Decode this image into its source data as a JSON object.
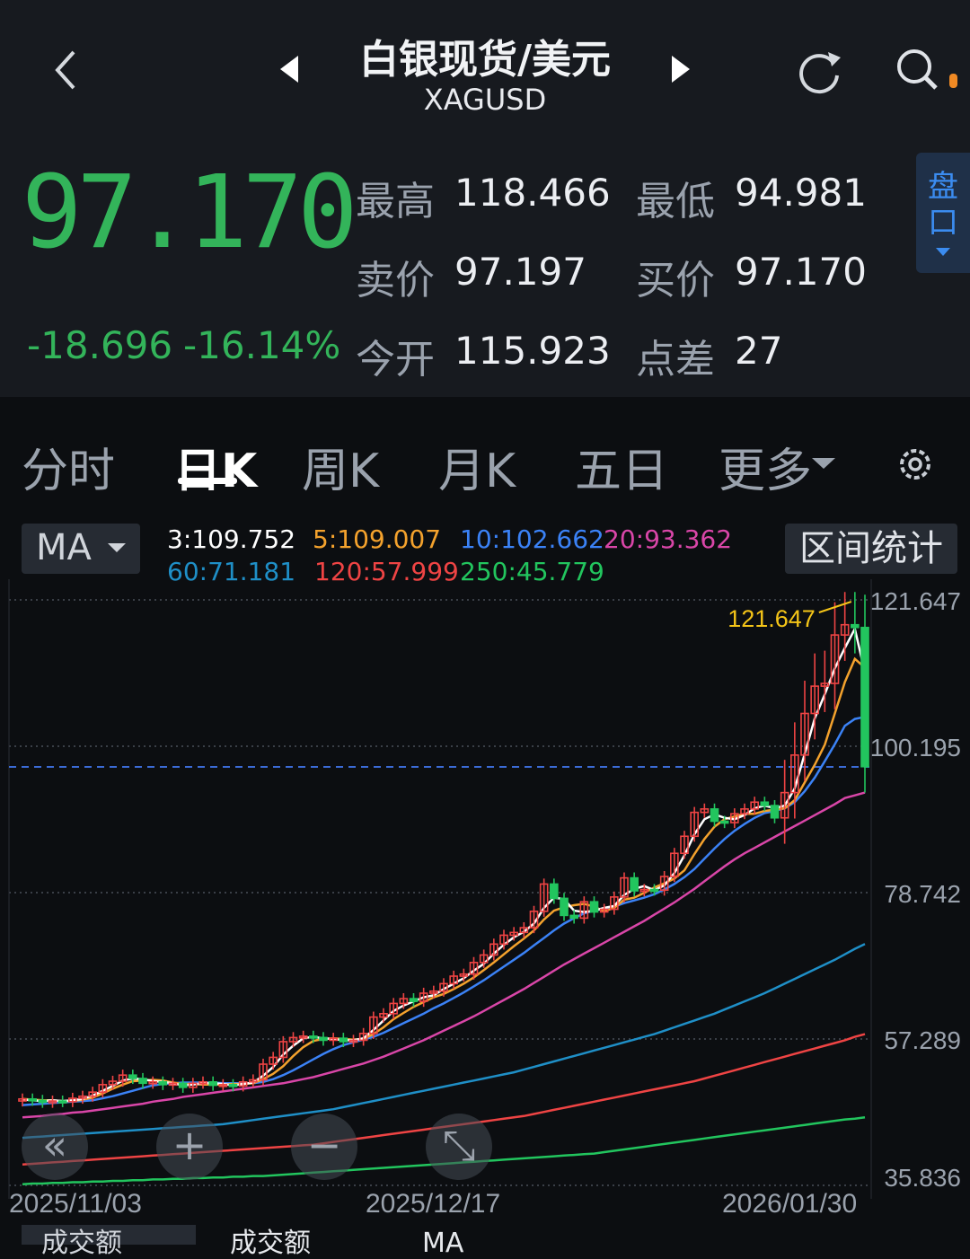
{
  "header": {
    "title": "白银现货/美元",
    "symbol": "XAGUSD",
    "price": "97.170",
    "change": "-18.696",
    "change_pct": "-16.14%",
    "stats": [
      {
        "label": "最高",
        "value": "118.466"
      },
      {
        "label": "最低",
        "value": "94.981"
      },
      {
        "label": "卖价",
        "value": "97.197"
      },
      {
        "label": "买价",
        "value": "97.170"
      },
      {
        "label": "今开",
        "value": "115.923"
      },
      {
        "label": "点差",
        "value": "27"
      }
    ],
    "pankou_label": [
      "盘",
      "口"
    ],
    "icons": {
      "back": "chevron-left-icon",
      "prev": "triangle-left-icon",
      "next": "triangle-right-icon",
      "refresh": "refresh-icon",
      "search": "search-icon"
    }
  },
  "tabs": [
    {
      "label": "分时",
      "active": false
    },
    {
      "label": "日K",
      "active": true
    },
    {
      "label": "周K",
      "active": false
    },
    {
      "label": "月K",
      "active": false
    },
    {
      "label": "五日",
      "active": false
    },
    {
      "label": "更多",
      "active": false
    }
  ],
  "indicator": {
    "select_label": "MA",
    "stats_button": "区间统计",
    "ma": [
      {
        "label": "3:109.752",
        "color": "#ffffff"
      },
      {
        "label": "5:109.007",
        "color": "#f4a22d"
      },
      {
        "label": "10:102.662",
        "color": "#3b82f6"
      },
      {
        "label": "20:93.362",
        "color": "#d946a8"
      },
      {
        "label": "60:71.181",
        "color": "#1f8fc7"
      },
      {
        "label": "120:57.999",
        "color": "#ef4444"
      },
      {
        "label": "250:45.779",
        "color": "#22c55e"
      }
    ]
  },
  "controls": [
    "«",
    "+",
    "−",
    "⤡"
  ],
  "chart_data": {
    "type": "candlestick",
    "y_ticks": [
      "121.647",
      "100.195",
      "78.742",
      "57.289",
      "35.836"
    ],
    "x_ticks": [
      "2025/11/03",
      "2025/12/17",
      "2026/01/30"
    ],
    "ylim": [
      35.836,
      121.647
    ],
    "current_price_line": 97.17,
    "max_marker_label": "121.647",
    "close": [
      48.5,
      48.3,
      48.0,
      48.2,
      48.1,
      48.6,
      48.9,
      49.5,
      50.6,
      51.1,
      52.0,
      51.5,
      50.8,
      51.0,
      50.6,
      50.8,
      50.2,
      50.8,
      51.0,
      50.5,
      50.6,
      50.4,
      51.0,
      51.3,
      53.6,
      54.6,
      56.9,
      57.5,
      57.7,
      57.5,
      57.1,
      57.4,
      56.9,
      57.1,
      58.1,
      60.5,
      61.0,
      62.5,
      63.2,
      62.8,
      64.0,
      64.3,
      65.4,
      66.5,
      66.8,
      68.5,
      69.6,
      71.2,
      72.5,
      72.9,
      73.6,
      76.0,
      80.0,
      77.9,
      75.4,
      75.0,
      77.4,
      75.9,
      76.3,
      78.1,
      80.9,
      79.0,
      79.2,
      79.1,
      81.1,
      84.5,
      87.0,
      90.5,
      91.0,
      89.2,
      89.0,
      90.3,
      91.0,
      92.0,
      91.5,
      89.7,
      93.4,
      98.9,
      105.0,
      109.0,
      109.4,
      116.5,
      118.0,
      117.6,
      97.2
    ],
    "ma": {
      "ma3": [
        48.4,
        48.3,
        48.2,
        48.3,
        48.2,
        48.3,
        48.5,
        49.0,
        49.7,
        50.4,
        51.2,
        51.5,
        51.4,
        51.1,
        51.0,
        50.8,
        50.5,
        50.6,
        50.8,
        50.8,
        50.7,
        50.5,
        50.7,
        50.9,
        51.9,
        53.2,
        55.0,
        56.3,
        57.4,
        57.6,
        57.4,
        57.3,
        57.1,
        57.1,
        57.4,
        58.6,
        60.0,
        61.4,
        62.2,
        62.8,
        63.4,
        63.7,
        64.6,
        65.4,
        66.2,
        67.3,
        68.3,
        69.8,
        71.1,
        72.2,
        73.0,
        74.2,
        76.5,
        78.0,
        77.8,
        76.1,
        75.9,
        76.1,
        76.5,
        76.8,
        78.4,
        79.3,
        79.7,
        79.1,
        79.8,
        81.6,
        84.2,
        87.3,
        89.5,
        90.2,
        89.7,
        89.5,
        90.1,
        91.1,
        91.5,
        91.1,
        91.5,
        94.0,
        99.1,
        104.3,
        107.8,
        111.6,
        114.6,
        117.4,
        111.0
      ],
      "ma5": [
        48.5,
        48.4,
        48.3,
        48.3,
        48.2,
        48.2,
        48.4,
        48.7,
        49.3,
        50.0,
        50.6,
        51.1,
        51.2,
        51.3,
        51.2,
        50.9,
        50.7,
        50.7,
        50.6,
        50.6,
        50.6,
        50.7,
        50.7,
        50.8,
        51.4,
        52.2,
        53.3,
        54.8,
        56.1,
        57.0,
        57.3,
        57.4,
        57.3,
        57.2,
        57.3,
        58.0,
        59.0,
        60.2,
        61.1,
        62.0,
        62.7,
        63.4,
        63.9,
        64.6,
        65.4,
        66.3,
        67.4,
        68.5,
        69.7,
        70.9,
        72.0,
        73.2,
        74.8,
        76.1,
        76.6,
        76.9,
        77.1,
        76.7,
        76.0,
        76.5,
        77.7,
        78.0,
        78.7,
        79.5,
        80.1,
        80.8,
        82.0,
        84.4,
        86.6,
        88.4,
        89.5,
        89.9,
        90.3,
        90.3,
        90.7,
        90.9,
        91.1,
        92.3,
        94.9,
        97.5,
        100.4,
        105.0,
        109.6,
        113.0,
        111.7
      ],
      "ma10": [
        47.6,
        47.7,
        47.8,
        47.9,
        48.0,
        48.1,
        48.2,
        48.3,
        48.6,
        48.9,
        49.3,
        49.7,
        50.1,
        50.5,
        50.7,
        50.8,
        50.9,
        50.9,
        50.9,
        50.9,
        50.8,
        50.8,
        50.8,
        50.8,
        51.0,
        51.4,
        52.0,
        52.7,
        53.5,
        54.3,
        55.1,
        55.8,
        56.4,
        56.8,
        57.2,
        57.6,
        58.2,
        58.9,
        59.6,
        60.3,
        61.0,
        61.8,
        62.5,
        63.3,
        64.1,
        65.0,
        65.9,
        66.9,
        67.9,
        68.9,
        69.9,
        71.0,
        72.1,
        73.2,
        74.2,
        75.0,
        75.7,
        76.1,
        76.4,
        76.7,
        77.2,
        77.6,
        78.0,
        78.5,
        79.2,
        80.0,
        81.0,
        82.2,
        83.7,
        85.2,
        86.6,
        87.8,
        88.8,
        89.7,
        90.4,
        90.7,
        91.1,
        92.0,
        93.6,
        95.6,
        98.0,
        100.5,
        103.2,
        104.2,
        104.5
      ],
      "ma20": [
        45.8,
        45.9,
        46.0,
        46.2,
        46.3,
        46.5,
        46.6,
        46.8,
        47.0,
        47.2,
        47.4,
        47.6,
        47.8,
        48.1,
        48.3,
        48.5,
        48.8,
        49.0,
        49.2,
        49.4,
        49.6,
        49.8,
        50.0,
        50.2,
        50.4,
        50.6,
        50.8,
        51.1,
        51.4,
        51.7,
        52.1,
        52.5,
        52.9,
        53.3,
        53.7,
        54.2,
        54.7,
        55.3,
        55.9,
        56.5,
        57.1,
        57.8,
        58.5,
        59.2,
        59.9,
        60.6,
        61.4,
        62.2,
        63.0,
        63.8,
        64.6,
        65.5,
        66.4,
        67.3,
        68.2,
        69.0,
        69.8,
        70.6,
        71.4,
        72.2,
        73.0,
        73.8,
        74.6,
        75.5,
        76.4,
        77.3,
        78.3,
        79.3,
        80.4,
        81.5,
        82.6,
        83.6,
        84.5,
        85.3,
        86.1,
        86.9,
        87.7,
        88.5,
        89.3,
        90.1,
        90.9,
        91.7,
        92.6,
        93.0,
        93.4
      ],
      "ma60": [
        42.8,
        42.9,
        43.0,
        43.1,
        43.2,
        43.3,
        43.4,
        43.5,
        43.6,
        43.7,
        43.8,
        43.9,
        44.0,
        44.1,
        44.2,
        44.3,
        44.4,
        44.5,
        44.6,
        44.7,
        44.8,
        45.0,
        45.2,
        45.4,
        45.6,
        45.8,
        46.0,
        46.2,
        46.4,
        46.6,
        46.8,
        47.0,
        47.3,
        47.6,
        47.9,
        48.2,
        48.5,
        48.8,
        49.1,
        49.4,
        49.7,
        50.0,
        50.3,
        50.6,
        50.9,
        51.2,
        51.5,
        51.8,
        52.1,
        52.4,
        52.8,
        53.2,
        53.6,
        54.0,
        54.4,
        54.8,
        55.2,
        55.6,
        56.0,
        56.4,
        56.8,
        57.2,
        57.6,
        58.0,
        58.5,
        59.0,
        59.5,
        60.0,
        60.5,
        61.0,
        61.6,
        62.2,
        62.8,
        63.4,
        64.0,
        64.7,
        65.4,
        66.1,
        66.8,
        67.5,
        68.2,
        68.9,
        69.7,
        70.5,
        71.2
      ],
      "ma120": [
        38.9,
        39.0,
        39.1,
        39.2,
        39.3,
        39.4,
        39.5,
        39.6,
        39.7,
        39.8,
        39.9,
        40.0,
        40.1,
        40.2,
        40.3,
        40.4,
        40.5,
        40.6,
        40.7,
        40.8,
        40.9,
        41.0,
        41.1,
        41.2,
        41.3,
        41.4,
        41.5,
        41.6,
        41.7,
        41.8,
        42.0,
        42.2,
        42.4,
        42.6,
        42.8,
        43.0,
        43.2,
        43.4,
        43.6,
        43.8,
        44.0,
        44.2,
        44.4,
        44.6,
        44.8,
        45.0,
        45.2,
        45.4,
        45.6,
        45.8,
        46.0,
        46.3,
        46.6,
        46.9,
        47.2,
        47.5,
        47.8,
        48.1,
        48.4,
        48.7,
        49.0,
        49.3,
        49.6,
        49.9,
        50.2,
        50.5,
        50.8,
        51.1,
        51.5,
        51.9,
        52.3,
        52.7,
        53.1,
        53.5,
        53.9,
        54.3,
        54.7,
        55.1,
        55.5,
        55.9,
        56.3,
        56.7,
        57.1,
        57.6,
        58.0
      ],
      "ma250": [
        36.0,
        36.1,
        36.1,
        36.2,
        36.2,
        36.3,
        36.3,
        36.4,
        36.4,
        36.5,
        36.5,
        36.6,
        36.6,
        36.7,
        36.7,
        36.8,
        36.8,
        36.9,
        36.9,
        37.0,
        37.0,
        37.1,
        37.1,
        37.2,
        37.2,
        37.3,
        37.4,
        37.5,
        37.6,
        37.7,
        37.8,
        37.9,
        38.0,
        38.1,
        38.2,
        38.3,
        38.4,
        38.5,
        38.6,
        38.7,
        38.8,
        38.9,
        39.0,
        39.1,
        39.2,
        39.3,
        39.4,
        39.5,
        39.6,
        39.7,
        39.8,
        39.9,
        40.0,
        40.1,
        40.2,
        40.3,
        40.4,
        40.5,
        40.7,
        40.9,
        41.1,
        41.3,
        41.5,
        41.7,
        41.9,
        42.1,
        42.3,
        42.5,
        42.7,
        42.9,
        43.1,
        43.3,
        43.5,
        43.7,
        43.9,
        44.1,
        44.3,
        44.5,
        44.7,
        44.9,
        45.1,
        45.3,
        45.5,
        45.6,
        45.8
      ]
    }
  },
  "bottom_partial": [
    "成交额",
    "成交额",
    "MA"
  ],
  "colors": {
    "up": "#ef4444",
    "down": "#22c55e",
    "accent": "#3b8cf0",
    "price": "#33b45a"
  }
}
